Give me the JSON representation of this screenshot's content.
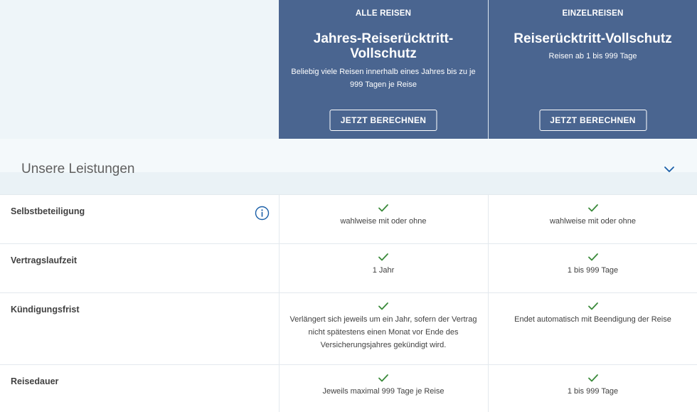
{
  "plans": [
    {
      "category": "ALLE REISEN",
      "title": "Jahres-Reiserücktritt-Vollschutz",
      "subtitle": "Beliebig viele Reisen innerhalb eines Jahres bis zu je 999 Tagen je Reise",
      "button": "JETZT BERECHNEN"
    },
    {
      "category": "EINZELREISEN",
      "title": "Reiserücktritt-Vollschutz",
      "subtitle": "Reisen ab 1 bis 999 Tage",
      "button": "JETZT BERECHNEN"
    }
  ],
  "section": {
    "title": "Unsere Leistungen",
    "icon": "chevron-down-icon"
  },
  "rows": [
    {
      "label": "Selbstbeteiligung",
      "has_info": true,
      "col1": "wahlweise mit oder ohne",
      "col2": "wahlweise mit oder ohne"
    },
    {
      "label": "Vertragslaufzeit",
      "col1": "1 Jahr",
      "col2": "1 bis 999 Tage"
    },
    {
      "label": "Kündigungsfrist",
      "col1": "Verlängert sich jeweils um ein Jahr, sofern der Vertrag nicht spätestens einen Monat vor Ende des Versicherungsjahres gekündigt wird.",
      "col2": "Endet automatisch mit Beendigung der Reise"
    },
    {
      "label": "Reisedauer",
      "col1": "Jeweils maximal 999 Tage je Reise",
      "col2": "1 bis 999 Tage"
    }
  ],
  "colors": {
    "header_blue": "#4a6590",
    "check_green": "#3a8a3a",
    "info_blue": "#1a5fa8",
    "chevron_blue": "#1a5fa8"
  }
}
